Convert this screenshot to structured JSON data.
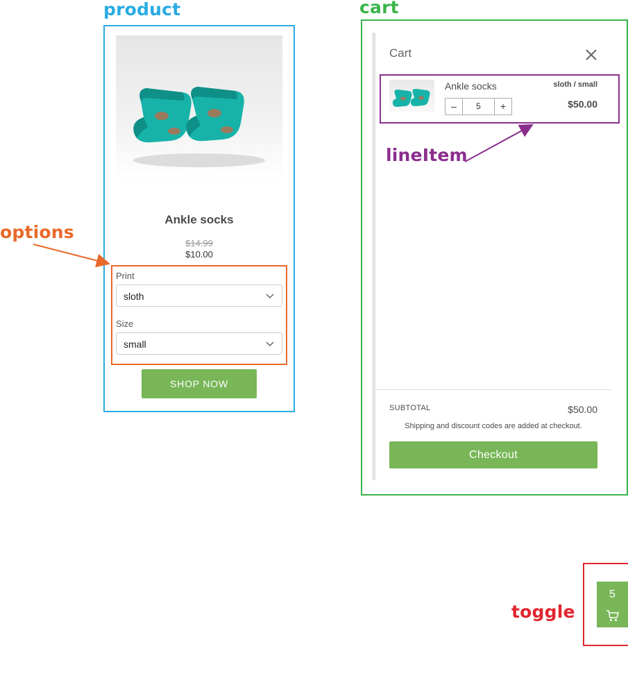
{
  "annotations": {
    "product": "product",
    "cart": "cart",
    "options": "options",
    "lineitem": "lineItem",
    "toggle": "toggle"
  },
  "colors": {
    "product": "#29abe2",
    "cart": "#3bb54a",
    "options": "#e8692a",
    "lineitem": "#8a2e8e",
    "toggle": "#e0262e",
    "button": "#78b657"
  },
  "product": {
    "title": "Ankle socks",
    "compare_at_price": "$14.99",
    "price": "$10.00",
    "image_icon": "socks-image",
    "options": [
      {
        "label": "Print",
        "selected": "sloth"
      },
      {
        "label": "Size",
        "selected": "small"
      }
    ],
    "button_label": "SHOP NOW"
  },
  "cart": {
    "title": "Cart",
    "line_item": {
      "title": "Ankle socks",
      "variant": "sloth / small",
      "price": "$50.00",
      "quantity": "5",
      "decrement": "–",
      "increment": "+"
    },
    "subtotal_label": "SUBTOTAL",
    "subtotal_value": "$50.00",
    "shipping_note": "Shipping and discount codes are added at checkout.",
    "checkout_label": "Checkout"
  },
  "toggle": {
    "count": "5",
    "icon": "cart-icon"
  }
}
